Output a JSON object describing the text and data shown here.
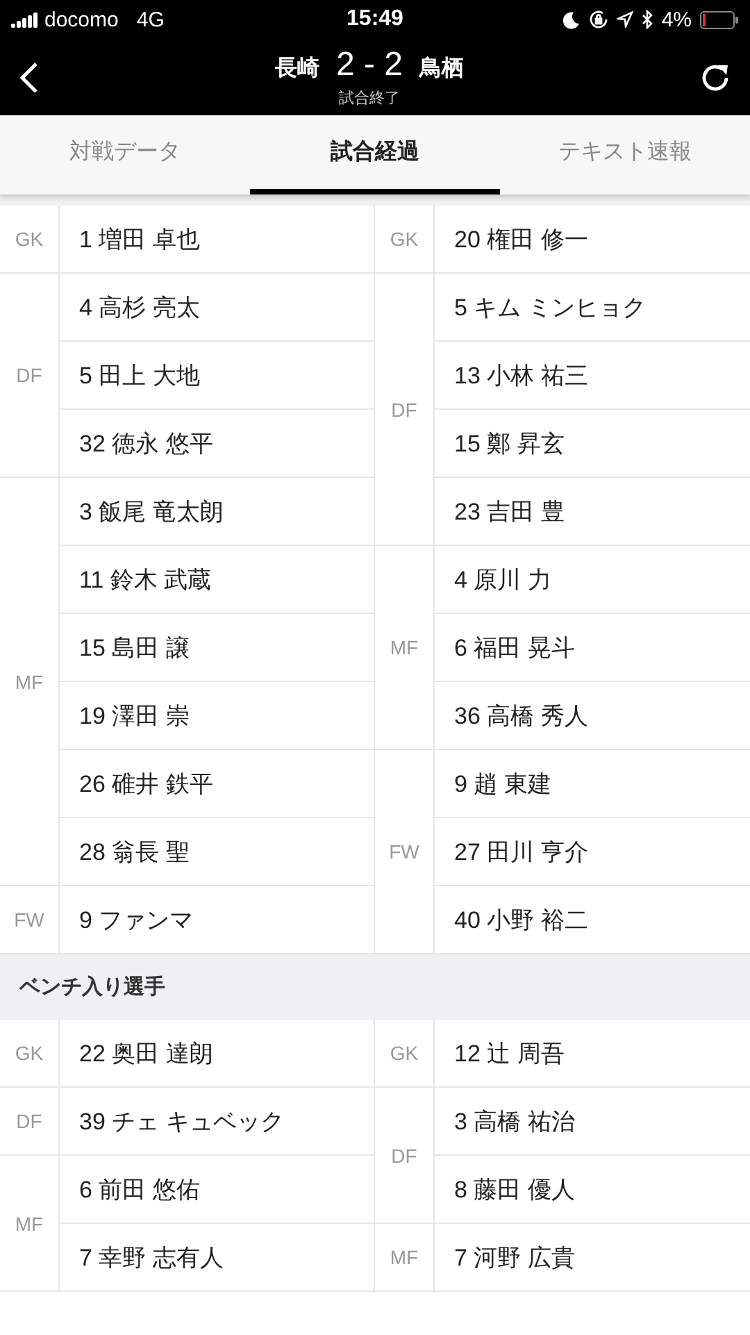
{
  "status_bar": {
    "carrier": "docomo",
    "network": "4G",
    "time": "15:49",
    "battery": "4%"
  },
  "header": {
    "home": "長崎",
    "score": "2 - 2",
    "away": "鳥栖",
    "status": "試合終了"
  },
  "tabs": [
    {
      "label": "対戦データ",
      "selected": false
    },
    {
      "label": "試合経過",
      "selected": true
    },
    {
      "label": "テキスト速報",
      "selected": false
    }
  ],
  "sections": [
    {
      "home": [
        {
          "position": "GK",
          "players": [
            "1 増田 卓也"
          ]
        },
        {
          "position": "DF",
          "players": [
            "4 高杉 亮太",
            "5 田上 大地",
            "32 徳永 悠平"
          ]
        },
        {
          "position": "MF",
          "players": [
            "3 飯尾 竜太朗",
            "11 鈴木 武蔵",
            "15 島田 譲",
            "19 澤田 崇",
            "26 碓井 鉄平",
            "28 翁長 聖"
          ]
        },
        {
          "position": "FW",
          "players": [
            "9 ファンマ"
          ]
        }
      ],
      "away": [
        {
          "position": "GK",
          "players": [
            "20 権田 修一"
          ]
        },
        {
          "position": "DF",
          "players": [
            "5 キム ミンヒョク",
            "13 小林 祐三",
            "15 鄭 昇玄",
            "23 吉田 豊"
          ]
        },
        {
          "position": "MF",
          "players": [
            "4 原川 力",
            "6 福田 晃斗",
            "36 高橋 秀人"
          ]
        },
        {
          "position": "FW",
          "players": [
            "9 趙 東建",
            "27 田川 亨介",
            "40 小野 裕二"
          ]
        }
      ]
    },
    {
      "title": "ベンチ入り選手",
      "home": [
        {
          "position": "GK",
          "players": [
            "22 奥田 達朗"
          ]
        },
        {
          "position": "DF",
          "players": [
            "39 チェ キュベック"
          ]
        },
        {
          "position": "MF",
          "players": [
            "6 前田 悠佑",
            "7 幸野 志有人"
          ]
        }
      ],
      "away": [
        {
          "position": "GK",
          "players": [
            "12 辻 周吾"
          ]
        },
        {
          "position": "DF",
          "players": [
            "3 高橋 祐治",
            "8 藤田 優人"
          ]
        },
        {
          "position": "MF",
          "players": [
            "7 河野 広貴"
          ]
        }
      ]
    }
  ]
}
